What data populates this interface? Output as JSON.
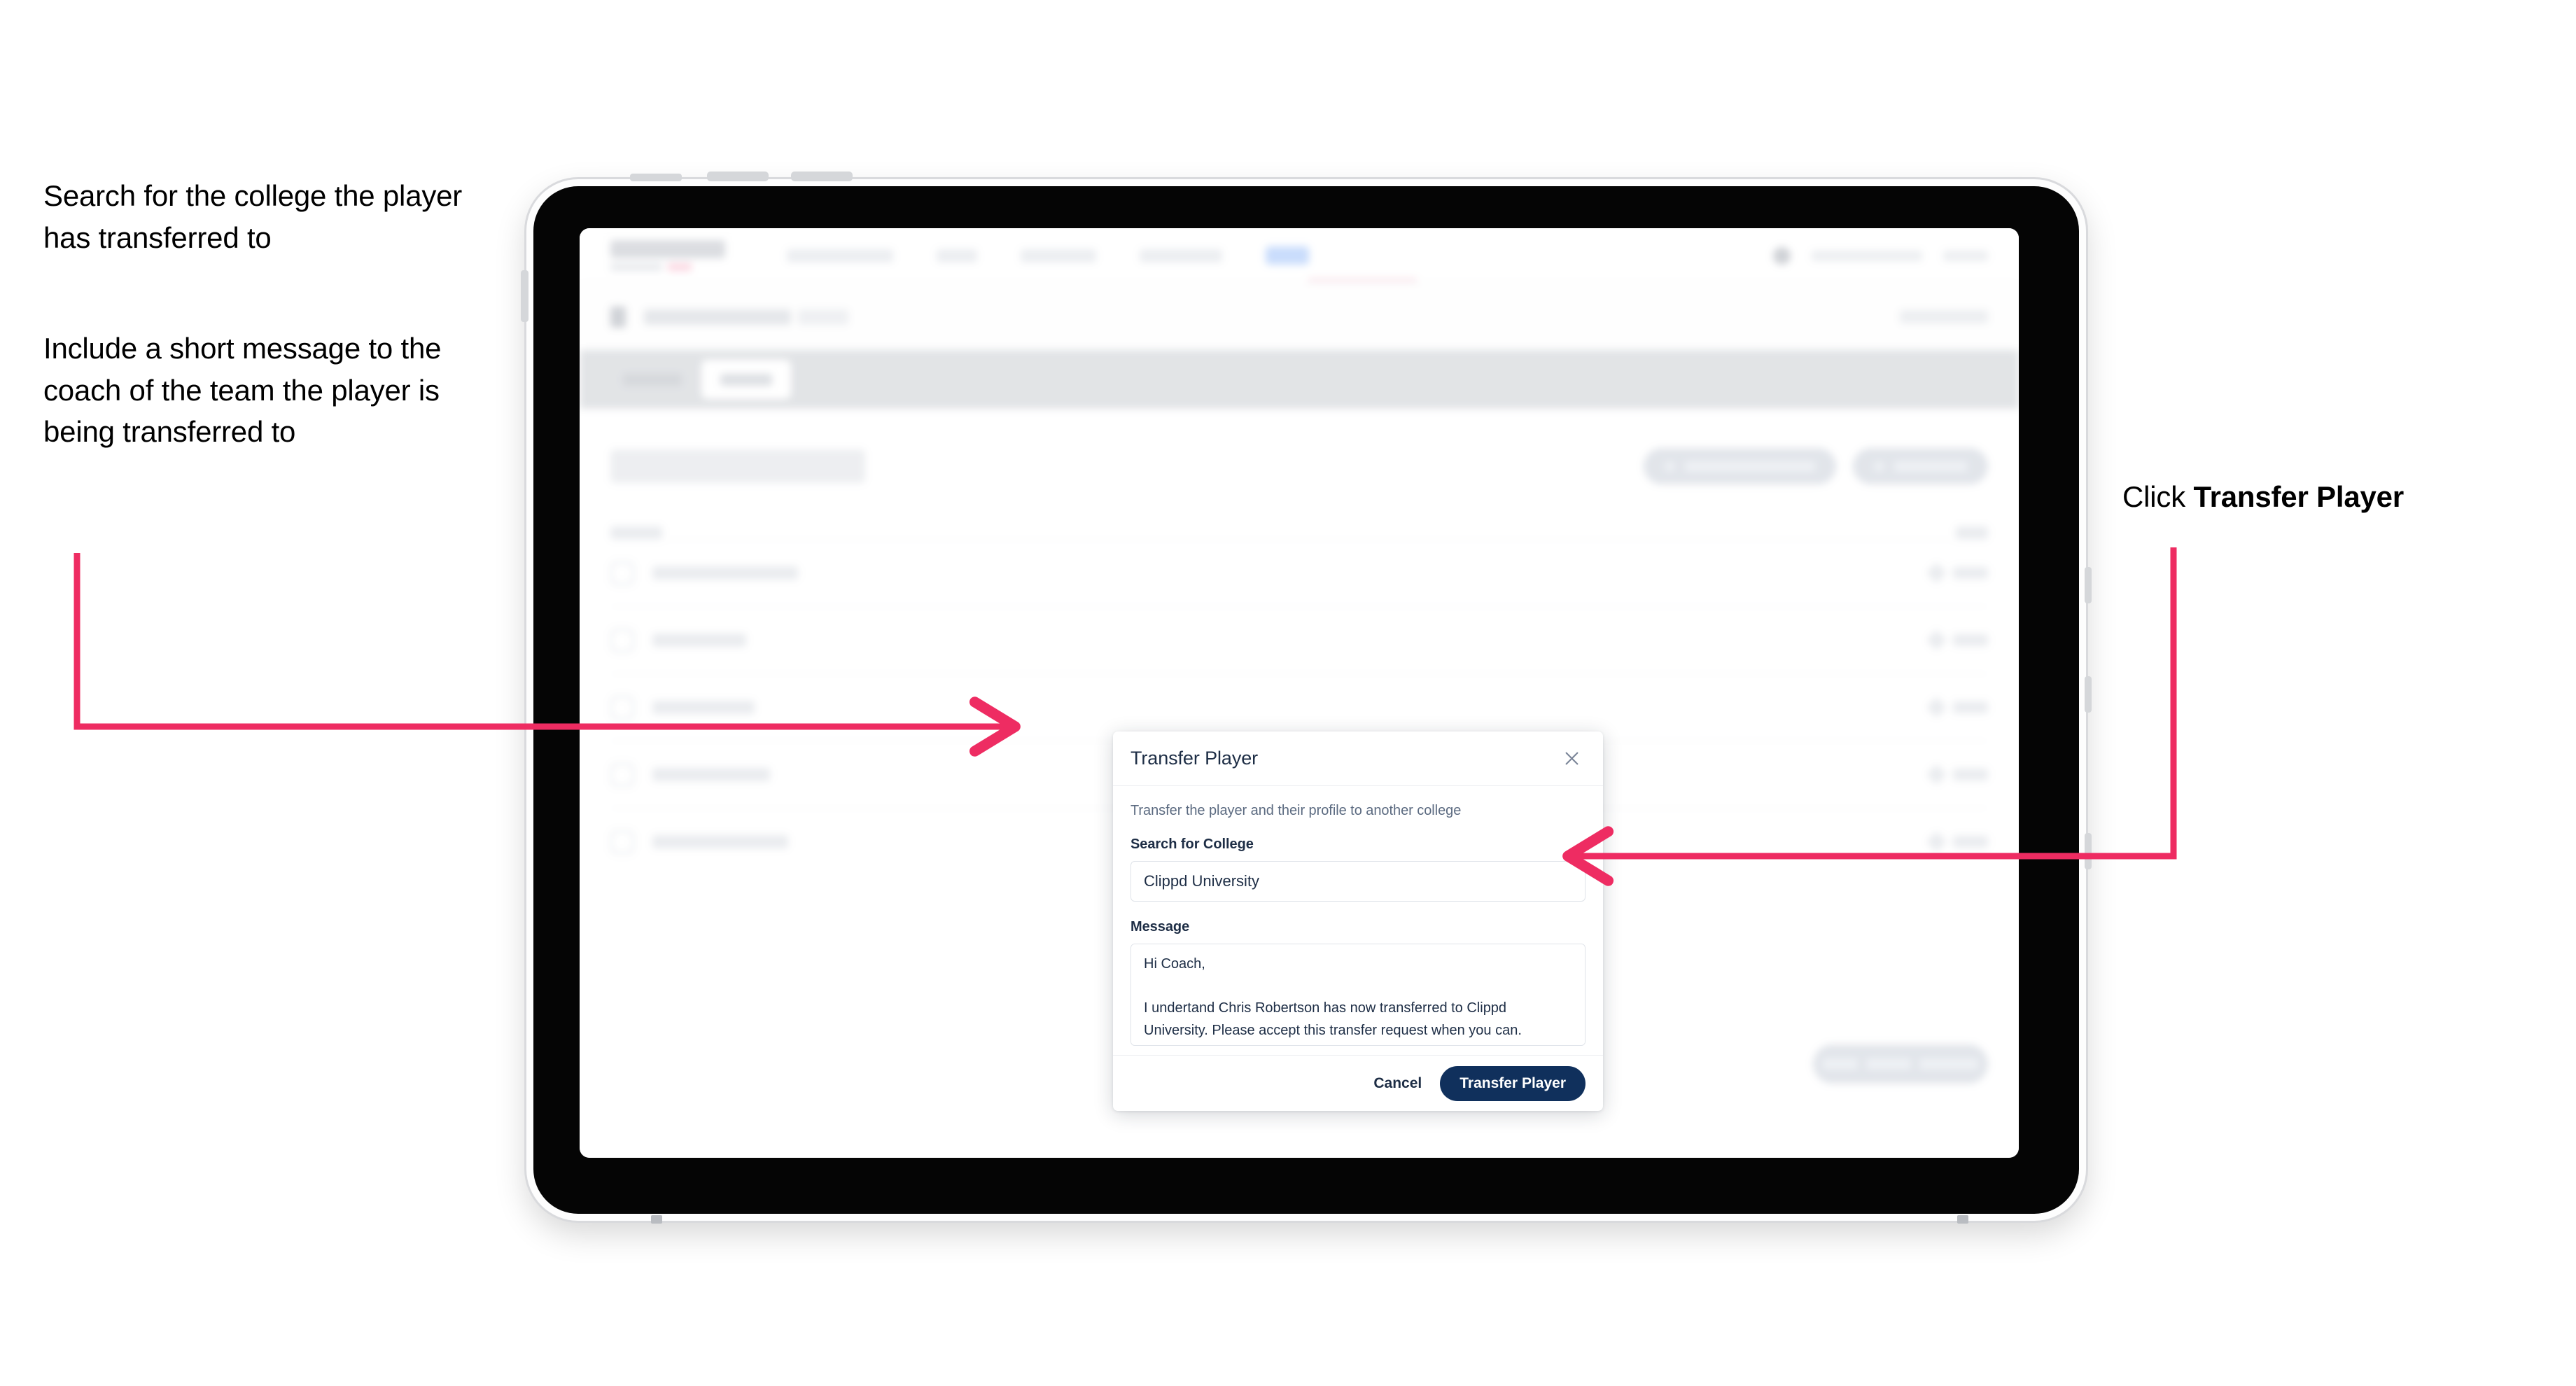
{
  "annotations": {
    "left_top": "Search for the college the player has transferred to",
    "left_bottom": "Include a short message to the coach of the team the player is being transferred to",
    "right_prefix": "Click ",
    "right_bold": "Transfer Player",
    "arrow_color": "#EE2C62"
  },
  "device": {
    "type": "tablet"
  },
  "app": {
    "nav": {
      "logo": "SCOREBOARD",
      "items": [
        "TOURNAMENTS",
        "TEAM",
        "SCHEDULE",
        "ANALYTICS"
      ],
      "cta": "Live",
      "user_email": "coach@clippd.io",
      "sign_out": "Sign Out"
    },
    "subheader": {
      "title": "Scoreboard",
      "title_muted": "Admin",
      "action": "Cancel"
    },
    "tabs": [
      {
        "label": "Details",
        "active": false
      },
      {
        "label": "Roster",
        "active": true
      }
    ],
    "page_title": "Update Roster",
    "header_buttons": [
      "Request Player Transfer",
      "Add Player"
    ],
    "list_header": {
      "left": "Name",
      "right": "EDIT"
    },
    "players": [
      {
        "name": "Chris Robertson",
        "edit": "Edit"
      },
      {
        "name": "Ian Wilson",
        "edit": "Edit"
      },
      {
        "name": "John Taylor",
        "edit": "Edit"
      },
      {
        "name": "Lewis Warren",
        "edit": "Edit"
      },
      {
        "name": "Nathan Hobson",
        "edit": "Edit"
      }
    ],
    "save_button": "Save Roster Changes"
  },
  "modal": {
    "title": "Transfer Player",
    "close_icon": "close-icon",
    "description": "Transfer the player and their profile to another college",
    "college_label": "Search for College",
    "college_value": "Clippd University",
    "college_placeholder": "Search for College",
    "message_label": "Message",
    "message_value": "Hi Coach,\n\nI undertand Chris Robertson has now transferred to Clippd University. Please accept this transfer request when you can.",
    "message_placeholder": "Message",
    "cancel_label": "Cancel",
    "submit_label": "Transfer Player",
    "submit_color": "#10305C"
  }
}
